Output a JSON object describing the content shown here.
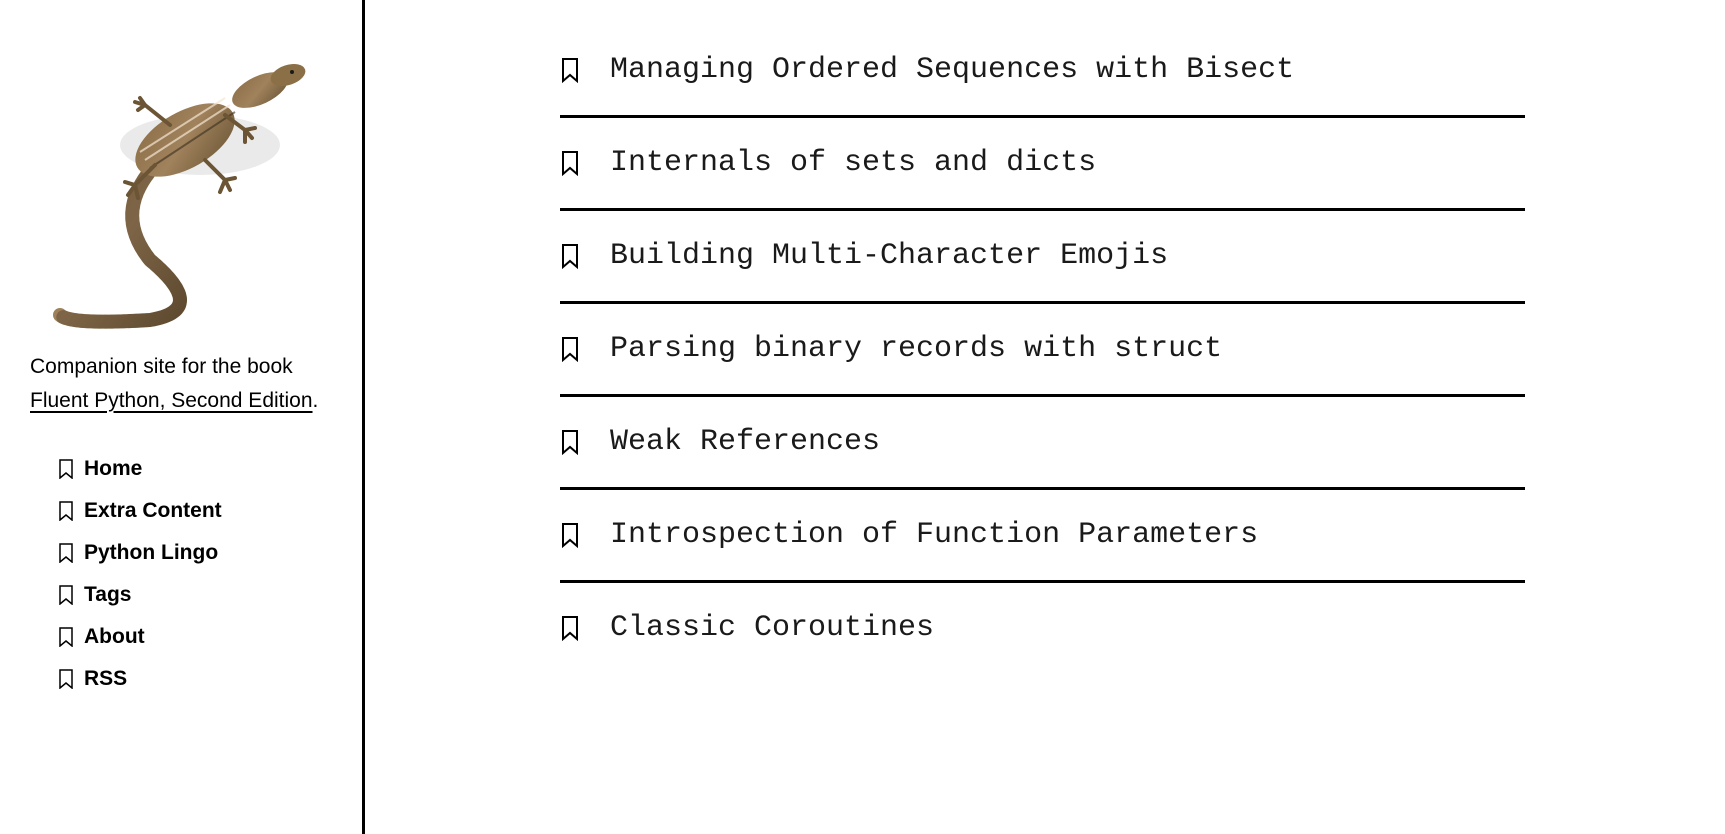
{
  "sidebar": {
    "description_prefix": "Companion site for the book ",
    "book_title": "Fluent Python, Second Edition",
    "description_suffix": ".",
    "nav": [
      {
        "label": "Home"
      },
      {
        "label": "Extra Content"
      },
      {
        "label": "Python Lingo"
      },
      {
        "label": "Tags"
      },
      {
        "label": "About"
      },
      {
        "label": "RSS"
      }
    ]
  },
  "main": {
    "articles": [
      {
        "title": "Managing Ordered Sequences with Bisect"
      },
      {
        "title": "Internals of sets and dicts"
      },
      {
        "title": "Building Multi-Character Emojis"
      },
      {
        "title": "Parsing binary records with struct"
      },
      {
        "title": "Weak References"
      },
      {
        "title": "Introspection of Function Parameters"
      },
      {
        "title": "Classic Coroutines"
      }
    ]
  }
}
